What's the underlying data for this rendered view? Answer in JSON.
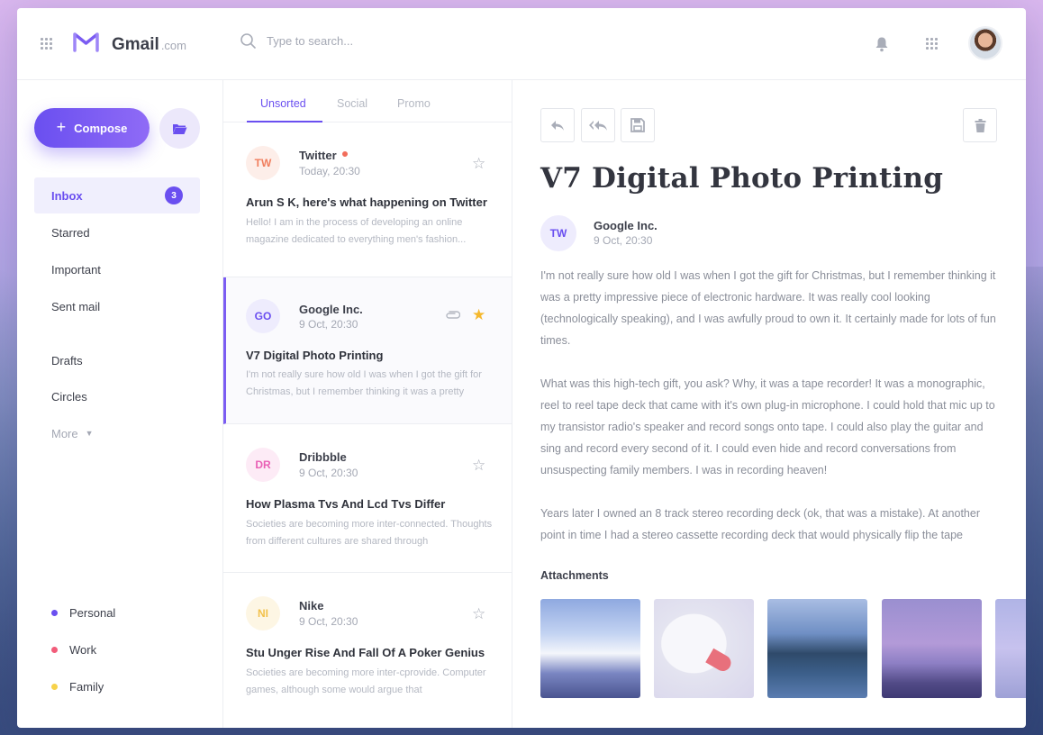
{
  "header": {
    "brand": "Gmail",
    "brand_domain": ".com",
    "search_placeholder": "Type to search..."
  },
  "sidebar": {
    "compose_label": "Compose",
    "nav": [
      {
        "label": "Inbox",
        "badge": "3"
      },
      {
        "label": "Starred"
      },
      {
        "label": "Important"
      },
      {
        "label": "Sent mail"
      },
      {
        "label": "Drafts"
      },
      {
        "label": "Circles"
      },
      {
        "label": "More"
      }
    ],
    "labels": [
      {
        "label": "Personal",
        "color": "#6a4ff0"
      },
      {
        "label": "Work",
        "color": "#f25c7a"
      },
      {
        "label": "Family",
        "color": "#f7d24a"
      }
    ]
  },
  "tabs": [
    "Unsorted",
    "Social",
    "Promo"
  ],
  "mails": [
    {
      "initials": "TW",
      "from": "Twitter",
      "time": "Today, 20:30",
      "subject": "Arun S K, here's what happening on Twitter",
      "preview": "Hello! I am in the process of developing an online magazine dedicated to everything men's fashion...",
      "avatar_bg": "#fdeee9",
      "avatar_fg": "#f07e5e"
    },
    {
      "initials": "GO",
      "from": "Google Inc.",
      "time": "9 Oct, 20:30",
      "subject": "V7 Digital Photo Printing",
      "preview": "I'm not really sure how old I was when I got the gift for Christmas, but I remember thinking it was a pretty",
      "avatar_bg": "#eeecfd",
      "avatar_fg": "#6a4ff0"
    },
    {
      "initials": "DR",
      "from": "Dribbble",
      "time": "9 Oct, 20:30",
      "subject": "How Plasma Tvs And Lcd Tvs Differ",
      "preview": "Societies are becoming more inter-connected. Thoughts from different cultures are shared through",
      "avatar_bg": "#fdebf6",
      "avatar_fg": "#e95fb5"
    },
    {
      "initials": "NI",
      "from": "Nike",
      "time": "9 Oct, 20:30",
      "subject": "Stu Unger Rise And Fall Of A Poker Genius",
      "preview": "Societies are becoming more inter-cprovide. Computer games, although some would argue that",
      "avatar_bg": "#fdf6e4",
      "avatar_fg": "#f2c14b"
    }
  ],
  "reader": {
    "subject": "V7 Digital Photo Printing",
    "sender_initials": "TW",
    "sender": "Google Inc.",
    "time": "9 Oct, 20:30",
    "paragraphs": [
      "I'm not really sure how old I was when I got the gift for Christmas, but I remember thinking it was a pretty impressive piece of electronic hardware. It was really cool looking (technologically speaking), and I was awfully proud to own it. It certainly made for lots of fun times.",
      "What was this high-tech gift, you ask? Why, it was a tape recorder! It was a monographic, reel to reel tape deck that came with it's own plug-in microphone. I could hold that mic up to my transistor radio's speaker and record songs onto tape. I could also play the guitar and sing and record every second of it. I could even hide and record conversations from unsuspecting family members. I was in recording heaven!",
      "Years later I owned an 8 track stereo recording deck (ok, that was a mistake). At another point in time I had a stereo cassette recording deck that would physically flip the tape"
    ],
    "attachments_title": "Attachments"
  },
  "colors": {
    "accent": "#6a4ff0",
    "star": "#f5b82e"
  }
}
